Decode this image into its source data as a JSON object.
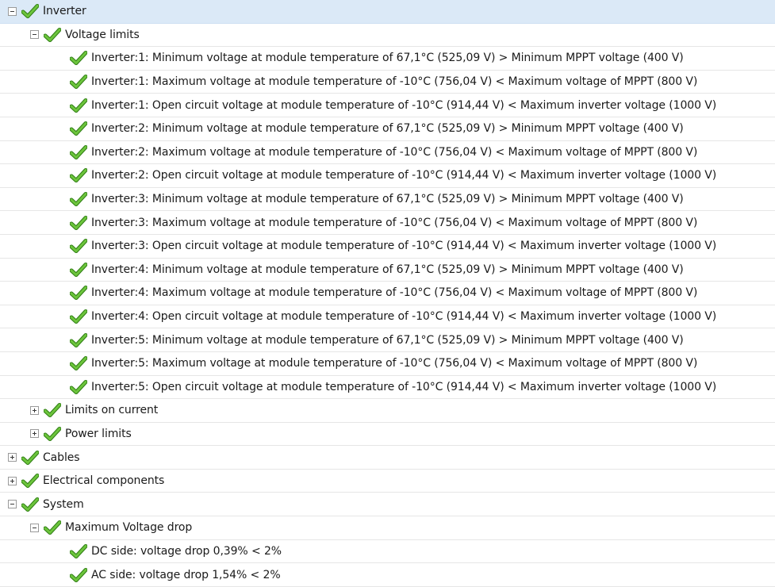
{
  "tree": [
    {
      "level": 0,
      "expanded": true,
      "selected": true,
      "label": "Inverter"
    },
    {
      "level": 1,
      "expanded": true,
      "label": "Voltage limits"
    },
    {
      "level": 2,
      "label": "Inverter:1: Minimum voltage at module temperature of 67,1°C (525,09 V) > Minimum MPPT voltage (400 V)"
    },
    {
      "level": 2,
      "label": "Inverter:1: Maximum voltage at module temperature of -10°C (756,04 V) < Maximum voltage of MPPT (800 V)"
    },
    {
      "level": 2,
      "label": "Inverter:1: Open circuit voltage at module temperature of -10°C (914,44 V) < Maximum inverter voltage (1000 V)"
    },
    {
      "level": 2,
      "label": "Inverter:2: Minimum voltage at module temperature of 67,1°C (525,09 V) > Minimum MPPT voltage (400 V)"
    },
    {
      "level": 2,
      "label": "Inverter:2: Maximum voltage at module temperature of -10°C (756,04 V) < Maximum voltage of MPPT (800 V)"
    },
    {
      "level": 2,
      "label": "Inverter:2: Open circuit voltage at module temperature of -10°C (914,44 V) < Maximum inverter voltage (1000 V)"
    },
    {
      "level": 2,
      "label": "Inverter:3: Minimum voltage at module temperature of 67,1°C (525,09 V) > Minimum MPPT voltage (400 V)"
    },
    {
      "level": 2,
      "label": "Inverter:3: Maximum voltage at module temperature of -10°C (756,04 V) < Maximum voltage of MPPT (800 V)"
    },
    {
      "level": 2,
      "label": "Inverter:3: Open circuit voltage at module temperature of -10°C (914,44 V) < Maximum inverter voltage (1000 V)"
    },
    {
      "level": 2,
      "label": "Inverter:4: Minimum voltage at module temperature of 67,1°C (525,09 V) > Minimum MPPT voltage (400 V)"
    },
    {
      "level": 2,
      "label": "Inverter:4: Maximum voltage at module temperature of -10°C (756,04 V) < Maximum voltage of MPPT (800 V)"
    },
    {
      "level": 2,
      "label": "Inverter:4: Open circuit voltage at module temperature of -10°C (914,44 V) < Maximum inverter voltage (1000 V)"
    },
    {
      "level": 2,
      "label": "Inverter:5: Minimum voltage at module temperature of 67,1°C (525,09 V) > Minimum MPPT voltage (400 V)"
    },
    {
      "level": 2,
      "label": "Inverter:5: Maximum voltage at module temperature of -10°C (756,04 V) < Maximum voltage of MPPT (800 V)"
    },
    {
      "level": 2,
      "label": "Inverter:5: Open circuit voltage at module temperature of -10°C (914,44 V) < Maximum inverter voltage (1000 V)"
    },
    {
      "level": 1,
      "expanded": false,
      "label": "Limits on current"
    },
    {
      "level": 1,
      "expanded": false,
      "label": "Power limits"
    },
    {
      "level": 0,
      "expanded": false,
      "label": "Cables"
    },
    {
      "level": 0,
      "expanded": false,
      "label": "Electrical components"
    },
    {
      "level": 0,
      "expanded": true,
      "label": "System"
    },
    {
      "level": 1,
      "expanded": true,
      "label": "Maximum Voltage drop"
    },
    {
      "level": 2,
      "label": "DC side:  voltage drop 0,39% < 2%"
    },
    {
      "level": 2,
      "label": "AC side:  voltage drop 1,54% < 2%"
    }
  ],
  "icons": {
    "status": "check-icon",
    "collapse": "collapse-icon",
    "expand": "expand-icon"
  },
  "colors": {
    "check_fill": "#5cb531",
    "check_outline": "#2f7d14",
    "selected_bg": "#dbe9f7",
    "row_border": "#e6e6e6"
  }
}
